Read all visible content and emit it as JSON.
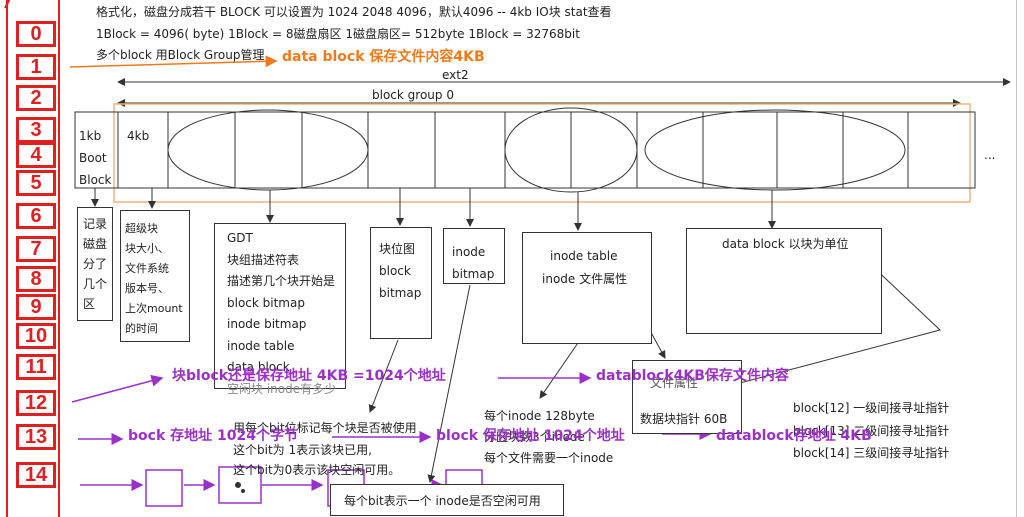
{
  "header_lines": [
    "格式化，磁盘分成若干 BLOCK  可以设置为 1024 2048 4096，默认4096 -- 4kb IO块    stat查看",
    "1Block = 4096( byte)  1Block = 8磁盘扇区  1磁盘扇区= 512byte  1Block = 32768bit",
    "多个block 用Block Group管理"
  ],
  "row_numbers": [
    "0",
    "1",
    "2",
    "3",
    "4",
    "5",
    "6",
    "7",
    "8",
    "9",
    "10",
    "11",
    "12",
    "13",
    "14"
  ],
  "top_left_mark": "7",
  "orange_note": "data block  保存文件内容4KB",
  "ext_label": "ext2",
  "bg_label": "block group 0",
  "ellipsis": "...",
  "cells": {
    "boot": [
      "1kb",
      "Boot",
      "Block"
    ],
    "super_size": "4kb"
  },
  "panels": {
    "partition": [
      "记录",
      "磁盘",
      "分了",
      "几个",
      "区"
    ],
    "superblock": [
      "超级块",
      "块大小、",
      "文件系统",
      "版本号、",
      "上次mount",
      "的时间"
    ],
    "gdt": [
      "GDT",
      "块组描述符表",
      "描述第几个块开始是",
      "block bitmap",
      "inode bitmap",
      "inode table",
      "data block",
      "空闲块  inode有多少"
    ],
    "block_bitmap": [
      "块位图",
      "block",
      "bitmap"
    ],
    "inode_bitmap": [
      "inode",
      "bitmap"
    ],
    "inode_table": {
      "title": "inode table",
      "row": "inode 文件属性"
    },
    "data_block": "data block 以块为单位",
    "file_attr": {
      "title": "文件属性",
      "row": "数据块指针 60B"
    }
  },
  "notes": {
    "bitmap_explain": [
      "用每个bit位标记每个块是否被使用",
      "这个bit为 1表示该块已用,",
      "这个bit为0表示该块空闲可用。"
    ],
    "inode_explain": [
      "每个inode 128byte",
      "分区块数3个inode",
      "每个文件需要一个inode"
    ],
    "inode_bitmap_explain": "每个bit表示一个 inode是否空闲可用",
    "indirect": [
      "block[12] 一级间接寻址指针",
      "block[13] 二级间接寻址指针",
      "block[14] 三级间接寻址指针"
    ]
  },
  "purple": {
    "row11_a": "块block还是保存地址  4KB =1024个地址",
    "row11_b": "datablock4KB保存文件内容",
    "row13_a": "bock 存地址  1024个字节",
    "row13_b": "block 保存地址  1024个地址",
    "row13_c": "datablock存地址  4KB"
  },
  "colors": {
    "red": "#e02020",
    "orange": "#f07a1a",
    "purple": "#9b30c8",
    "line": "#333333"
  }
}
